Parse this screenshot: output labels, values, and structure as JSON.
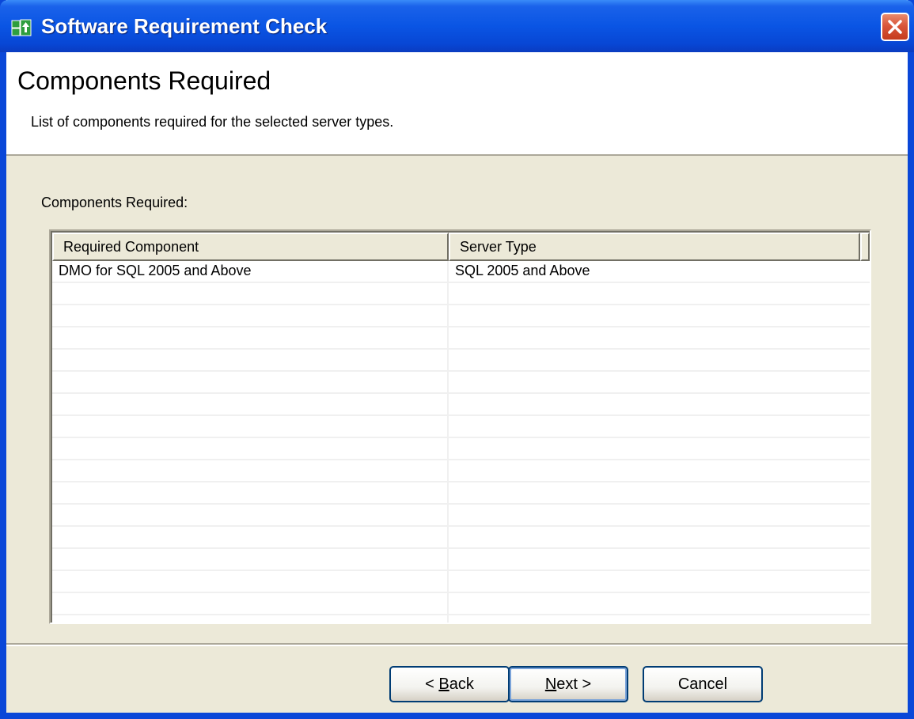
{
  "window": {
    "title": "Software Requirement Check",
    "close_label": "×"
  },
  "header": {
    "title": "Components Required",
    "subtitle": "List of components required for the selected server types."
  },
  "list": {
    "label": "Components Required:",
    "columns": [
      "Required Component",
      "Server Type"
    ],
    "rows": [
      [
        "DMO for SQL 2005 and Above",
        "SQL 2005 and Above"
      ]
    ]
  },
  "buttons": {
    "back": {
      "prefix": "< ",
      "mnemonic": "B",
      "rest": "ack"
    },
    "next": {
      "mnemonic": "N",
      "rest": "ext >"
    },
    "cancel": "Cancel"
  },
  "colors": {
    "titlebar_blue": "#0a55e4",
    "close_red": "#d9563a",
    "dialog_bg": "#ece9d8"
  },
  "icons": {
    "app": "software-update-icon",
    "close": "close-icon"
  }
}
